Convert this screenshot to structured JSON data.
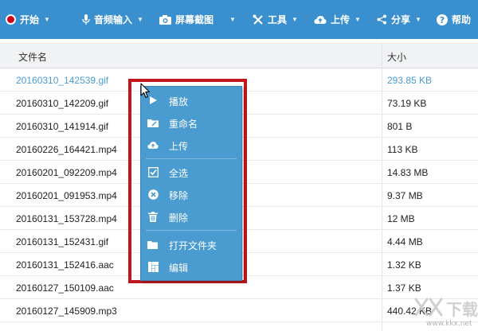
{
  "toolbar": {
    "items": [
      {
        "label": "开始",
        "icon": "record-icon"
      },
      {
        "label": "音频输入",
        "icon": "microphone-icon"
      },
      {
        "label": "屏幕截图",
        "icon": "camera-icon"
      },
      {
        "label": "工具",
        "icon": "tools-icon"
      },
      {
        "label": "上传",
        "icon": "cloud-upload-icon"
      },
      {
        "label": "分享",
        "icon": "share-icon"
      },
      {
        "label": "帮助",
        "icon": "help-icon"
      }
    ],
    "background": "#3a8fce",
    "record_color": "#d0021b"
  },
  "table": {
    "headers": {
      "name": "文件名",
      "size": "大小"
    },
    "rows": [
      {
        "name": "20160310_142539.gif",
        "size": "293.85 KB"
      },
      {
        "name": "20160310_142209.gif",
        "size": "73.19 KB"
      },
      {
        "name": "20160310_141914.gif",
        "size": "801 B"
      },
      {
        "name": "20160226_164421.mp4",
        "size": "113 KB"
      },
      {
        "name": "20160201_092209.mp4",
        "size": "14.83 MB"
      },
      {
        "name": "20160201_091953.mp4",
        "size": "9.37 MB"
      },
      {
        "name": "20160131_153728.mp4",
        "size": "12 MB"
      },
      {
        "name": "20160131_152431.gif",
        "size": "4.44 MB"
      },
      {
        "name": "20160131_152416.aac",
        "size": "1.32 KB"
      },
      {
        "name": "20160127_150109.aac",
        "size": "1.37 KB"
      },
      {
        "name": "20160127_145909.mp3",
        "size": "440.42 KB"
      }
    ],
    "selected_color": "#4a9bd4"
  },
  "context_menu": {
    "items": [
      {
        "label": "播放",
        "icon": "play-icon"
      },
      {
        "label": "重命名",
        "icon": "rename-icon"
      },
      {
        "label": "上传",
        "icon": "cloud-upload-icon"
      },
      {
        "label": "全选",
        "icon": "checkbox-icon"
      },
      {
        "label": "移除",
        "icon": "remove-icon"
      },
      {
        "label": "删除",
        "icon": "trash-icon"
      },
      {
        "label": "打开文件夹",
        "icon": "folder-icon"
      },
      {
        "label": "编辑",
        "icon": "edit-icon"
      }
    ],
    "background": "#4a9bd0",
    "highlight_color": "#c0161c"
  },
  "watermark": {
    "text": "下载",
    "url": "www.kkx.net"
  }
}
